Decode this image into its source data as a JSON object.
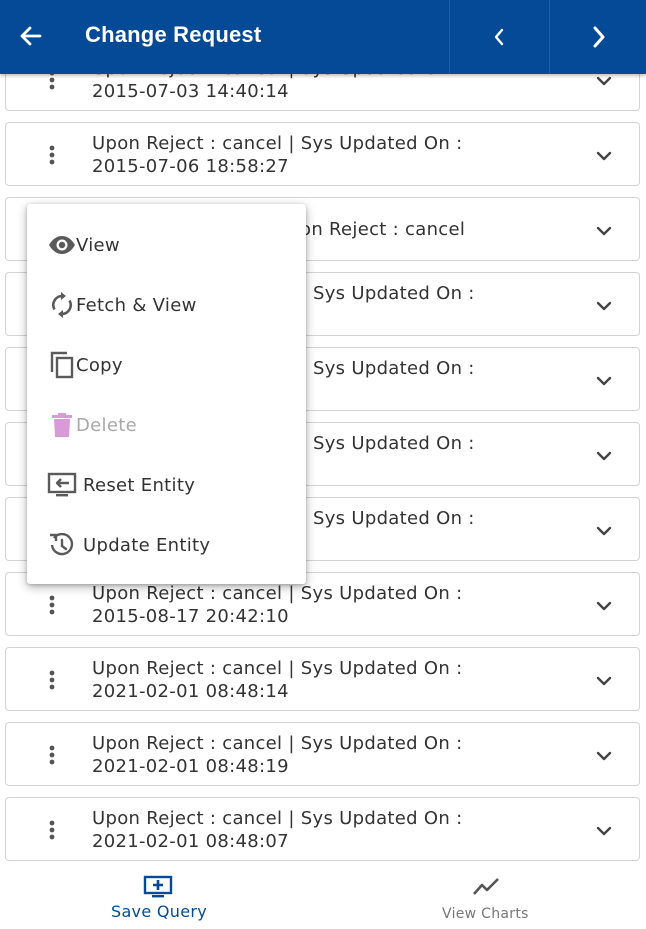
{
  "header": {
    "title": "Change Request",
    "back_icon": "arrow-left-icon",
    "prev_icon": "chevron-left-icon",
    "next_icon": "chevron-right-icon",
    "color": "#054a96"
  },
  "rows": [
    {
      "line1": "Upon Reject : cancel | Sys Updated On :",
      "line2": "2015-07-03 14:40:14"
    },
    {
      "line1": "Upon Reject : cancel | Sys Updated On :",
      "line2": "2015-07-06 18:58:27"
    },
    {
      "line1": "on Reject : cancel",
      "line2": ""
    },
    {
      "line1": "Sys Updated On :",
      "line2": ""
    },
    {
      "line1": "Sys Updated On :",
      "line2": ""
    },
    {
      "line1": "Sys Updated On :",
      "line2": ""
    },
    {
      "line1": "Sys Updated On :",
      "line2": ""
    },
    {
      "line1": "Upon Reject : cancel | Sys Updated On :",
      "line2": "2015-08-17 20:42:10"
    },
    {
      "line1": "Upon Reject : cancel | Sys Updated On :",
      "line2": "2021-02-01 08:48:14"
    },
    {
      "line1": "Upon Reject : cancel | Sys Updated On :",
      "line2": "2021-02-01 08:48:19"
    },
    {
      "line1": "Upon Reject : cancel | Sys Updated On :",
      "line2": "2021-02-01 08:48:07"
    }
  ],
  "context_menu": {
    "items": [
      {
        "label": "View",
        "icon": "eye-icon",
        "enabled": true
      },
      {
        "label": "Fetch & View",
        "icon": "sync-icon",
        "enabled": true
      },
      {
        "label": "Copy",
        "icon": "copy-icon",
        "enabled": true
      },
      {
        "label": "Delete",
        "icon": "trash-icon",
        "enabled": false
      },
      {
        "label": "Reset Entity",
        "icon": "reset-entity-icon",
        "enabled": true
      },
      {
        "label": "Update Entity",
        "icon": "update-entity-icon",
        "enabled": true
      }
    ]
  },
  "bottom_bar": {
    "save_query": {
      "label": "Save Query",
      "icon": "add-to-screen-icon"
    },
    "view_charts": {
      "label": "View Charts",
      "icon": "line-chart-icon"
    }
  }
}
